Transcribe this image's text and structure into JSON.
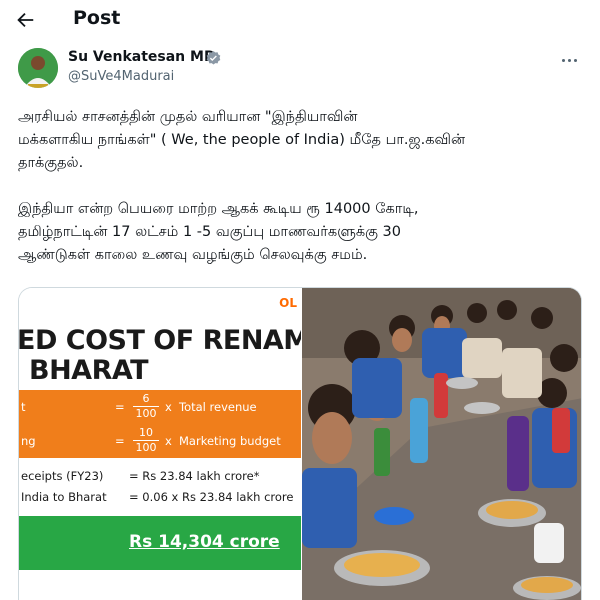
{
  "header": {
    "title": "Post"
  },
  "author": {
    "name": "Su Venkatesan MP",
    "handle": "@SuVe4Madurai"
  },
  "tweet": {
    "lines_p1": [
      "அரசியல் சாசனத்தின் முதல் வரியான \"இந்தியாவின்",
      "மக்களாகிய நாங்கள்\" ( We, the people of India) மீதே பா.ஜ.கவின்",
      "தாக்குதல்."
    ],
    "lines_p2": [
      "இந்தியா என்ற பெயரை மாற்ற ஆகக் கூடிய ரூ 14000 கோடி,",
      "தமிழ்நாட்டின் 17 லட்சம் 1 -5 வகுப்பு மாணவர்களுக்கு 30",
      "ஆண்டுகள் காலை உணவு  வழங்கும் செலவுக்கு சமம்."
    ]
  },
  "infographic": {
    "logo": "OL",
    "title_line1": "ED COST OF RENAMING",
    "title_line2": "BHARAT",
    "row1": {
      "label": "t",
      "eq": "=",
      "num": "6",
      "den": "100",
      "x": "x",
      "rest": "Total revenue"
    },
    "row2": {
      "label": "ng",
      "eq": "=",
      "num": "10",
      "den": "100",
      "x": "x",
      "rest": "Marketing budget"
    },
    "calc1": {
      "label": "eceipts (FY23)",
      "value": "=  Rs 23.84 lakh crore*"
    },
    "calc2": {
      "label": "India to Bharat",
      "value": "=  0.06 x  Rs 23.84 lakh crore"
    },
    "total": "Rs 14,304 crore"
  },
  "colors": {
    "accent": "#1d9bf0",
    "orange": "#f07e1b",
    "green": "#28a745"
  }
}
